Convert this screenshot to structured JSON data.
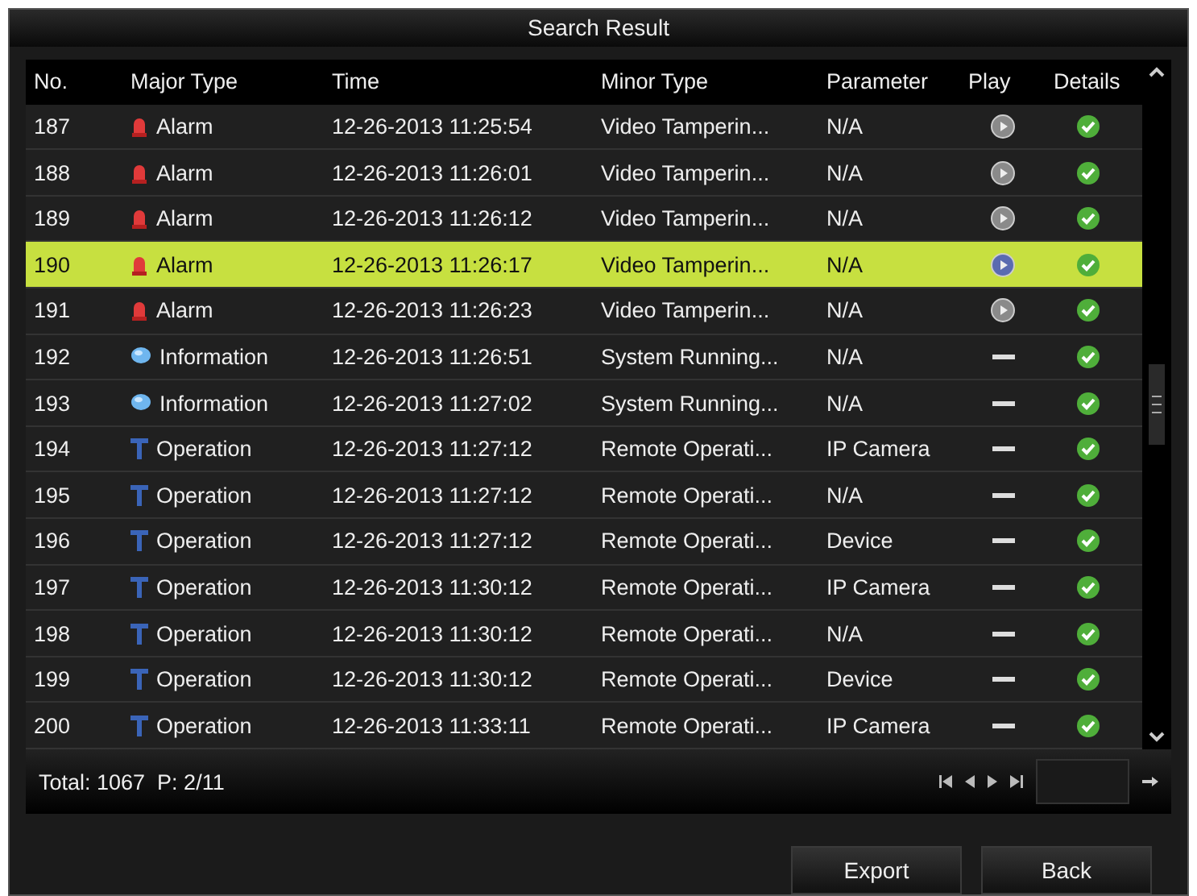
{
  "window": {
    "title": "Search Result"
  },
  "table": {
    "columns": [
      "No.",
      "Major Type",
      "Time",
      "Minor Type",
      "Parameter",
      "Play",
      "Details"
    ],
    "rows": [
      {
        "no": "187",
        "major_type": {
          "kind": "alarm",
          "label": "Alarm"
        },
        "time": "12-26-2013 11:25:54",
        "minor_type": "Video Tamperin...",
        "parameter": "N/A",
        "play": {
          "kind": "button"
        },
        "selected": false
      },
      {
        "no": "188",
        "major_type": {
          "kind": "alarm",
          "label": "Alarm"
        },
        "time": "12-26-2013 11:26:01",
        "minor_type": "Video Tamperin...",
        "parameter": "N/A",
        "play": {
          "kind": "button"
        },
        "selected": false
      },
      {
        "no": "189",
        "major_type": {
          "kind": "alarm",
          "label": "Alarm"
        },
        "time": "12-26-2013 11:26:12",
        "minor_type": "Video Tamperin...",
        "parameter": "N/A",
        "play": {
          "kind": "button"
        },
        "selected": false
      },
      {
        "no": "190",
        "major_type": {
          "kind": "alarm",
          "label": "Alarm"
        },
        "time": "12-26-2013 11:26:17",
        "minor_type": "Video Tamperin...",
        "parameter": "N/A",
        "play": {
          "kind": "button"
        },
        "selected": true
      },
      {
        "no": "191",
        "major_type": {
          "kind": "alarm",
          "label": "Alarm"
        },
        "time": "12-26-2013 11:26:23",
        "minor_type": "Video Tamperin...",
        "parameter": "N/A",
        "play": {
          "kind": "button"
        },
        "selected": false
      },
      {
        "no": "192",
        "major_type": {
          "kind": "information",
          "label": "Information"
        },
        "time": "12-26-2013 11:26:51",
        "minor_type": "System Running...",
        "parameter": "N/A",
        "play": {
          "kind": "none"
        },
        "selected": false
      },
      {
        "no": "193",
        "major_type": {
          "kind": "information",
          "label": "Information"
        },
        "time": "12-26-2013 11:27:02",
        "minor_type": "System Running...",
        "parameter": "N/A",
        "play": {
          "kind": "none"
        },
        "selected": false
      },
      {
        "no": "194",
        "major_type": {
          "kind": "operation",
          "label": "Operation"
        },
        "time": "12-26-2013 11:27:12",
        "minor_type": "Remote Operati...",
        "parameter": "IP Camera",
        "play": {
          "kind": "none"
        },
        "selected": false
      },
      {
        "no": "195",
        "major_type": {
          "kind": "operation",
          "label": "Operation"
        },
        "time": "12-26-2013 11:27:12",
        "minor_type": "Remote Operati...",
        "parameter": "N/A",
        "play": {
          "kind": "none"
        },
        "selected": false
      },
      {
        "no": "196",
        "major_type": {
          "kind": "operation",
          "label": "Operation"
        },
        "time": "12-26-2013 11:27:12",
        "minor_type": "Remote Operati...",
        "parameter": "Device",
        "play": {
          "kind": "none"
        },
        "selected": false
      },
      {
        "no": "197",
        "major_type": {
          "kind": "operation",
          "label": "Operation"
        },
        "time": "12-26-2013 11:30:12",
        "minor_type": "Remote Operati...",
        "parameter": "IP Camera",
        "play": {
          "kind": "none"
        },
        "selected": false
      },
      {
        "no": "198",
        "major_type": {
          "kind": "operation",
          "label": "Operation"
        },
        "time": "12-26-2013 11:30:12",
        "minor_type": "Remote Operati...",
        "parameter": "N/A",
        "play": {
          "kind": "none"
        },
        "selected": false
      },
      {
        "no": "199",
        "major_type": {
          "kind": "operation",
          "label": "Operation"
        },
        "time": "12-26-2013 11:30:12",
        "minor_type": "Remote Operati...",
        "parameter": "Device",
        "play": {
          "kind": "none"
        },
        "selected": false
      },
      {
        "no": "200",
        "major_type": {
          "kind": "operation",
          "label": "Operation"
        },
        "time": "12-26-2013 11:33:11",
        "minor_type": "Remote Operati...",
        "parameter": "IP Camera",
        "play": {
          "kind": "none"
        },
        "selected": false
      }
    ]
  },
  "footer": {
    "summary": "Total: 1067  P: 2/11"
  },
  "buttons": [
    "Export",
    "Back"
  ]
}
